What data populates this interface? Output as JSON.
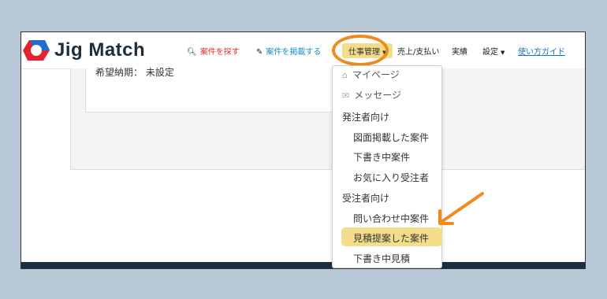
{
  "app": {
    "name": "Jig Match"
  },
  "nav": {
    "search_label": "案件を探す",
    "post_label": "案件を掲載する",
    "job_manage_label": "仕事管理",
    "sales_label": "売上/支払い",
    "results_label": "実績",
    "settings_label": "設定",
    "guide_label": "使い方ガイド"
  },
  "page": {
    "deadline_text": "希望納期： 未設定"
  },
  "dropdown": {
    "mypage": "マイページ",
    "messages": "メッセージ",
    "client_header": "発注者向け",
    "client_items": [
      "図面掲載した案件",
      "下書き中案件",
      "お気に入り受注者"
    ],
    "contractor_header": "受注者向け",
    "contractor_items": [
      "問い合わせ中案件",
      "見積提案した案件",
      "下書き中見積"
    ],
    "selected_item": "見積提案した案件"
  },
  "colors": {
    "background": "#b8c8d6",
    "highlight": "#f3dd8a",
    "annotation": "#f08a1c",
    "search_link": "#e03030",
    "post_link": "#1a8fc8",
    "guide_link": "#1a6fd0",
    "footer": "#1c2e45"
  },
  "icons": {
    "logo": "jig-match-logo-icon",
    "search": "magnifier-icon",
    "post": "pencil-icon",
    "mypage": "home-icon",
    "messages": "envelope-icon",
    "caret": "caret-down-icon"
  }
}
